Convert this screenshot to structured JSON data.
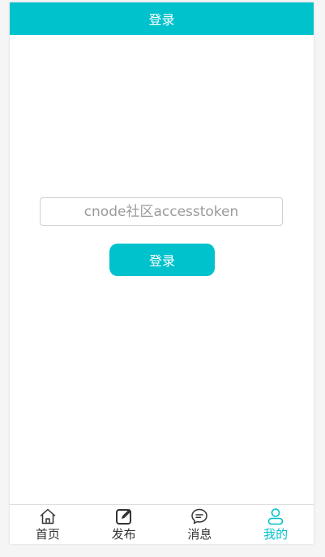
{
  "colors": {
    "primary": "#00c2cc",
    "tab_text": "#333333"
  },
  "header": {
    "title": "登录"
  },
  "login": {
    "placeholder": "cnode社区accesstoken",
    "value": "",
    "button_label": "登录"
  },
  "tabbar": {
    "items": [
      {
        "label": "首页",
        "icon": "home-icon",
        "active": false
      },
      {
        "label": "发布",
        "icon": "edit-icon",
        "active": false
      },
      {
        "label": "消息",
        "icon": "message-icon",
        "active": false
      },
      {
        "label": "我的",
        "icon": "user-icon",
        "active": true
      }
    ]
  }
}
